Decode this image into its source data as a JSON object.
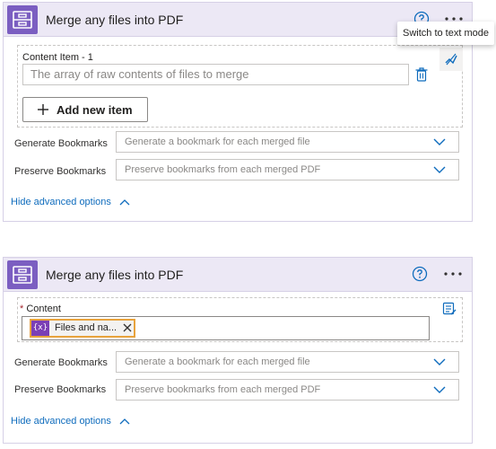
{
  "card1": {
    "title": "Merge any files into PDF",
    "tooltip": "Switch to text mode",
    "array_item_label": "Content Item - 1",
    "array_item_placeholder": "The array of raw contents of files to merge",
    "add_item_label": "Add new item",
    "generate_bookmarks_label": "Generate Bookmarks",
    "generate_bookmarks_placeholder": "Generate a bookmark for each merged file",
    "preserve_bookmarks_label": "Preserve Bookmarks",
    "preserve_bookmarks_placeholder": "Preserve bookmarks from each merged PDF",
    "hide_advanced_label": "Hide advanced options"
  },
  "card2": {
    "title": "Merge any files into PDF",
    "content_required_mark": "*",
    "content_label": "Content",
    "token_icon_text": "{x}",
    "token_label": "Files and na...",
    "generate_bookmarks_label": "Generate Bookmarks",
    "generate_bookmarks_placeholder": "Generate a bookmark for each merged file",
    "preserve_bookmarks_label": "Preserve Bookmarks",
    "preserve_bookmarks_placeholder": "Preserve bookmarks from each merged PDF",
    "hide_advanced_label": "Hide advanced options"
  },
  "icons": {
    "app": "archive-box-icon",
    "help": "help-circle-icon",
    "more": "more-ellipsis-icon",
    "switch_mode": "switch-text-mode-icon",
    "delete": "trash-icon",
    "add": "plus-icon",
    "dropdown": "chevron-down-icon",
    "collapse": "chevron-up-icon",
    "remove_token": "close-icon",
    "code_view": "code-view-icon"
  },
  "colors": {
    "brand": "#7b5ec1",
    "header_bg": "#ece8f5",
    "link": "#0f6cbd",
    "token_border": "#e8a33d",
    "token_icon_bg": "#7b3fb5",
    "required": "#a4262c"
  }
}
